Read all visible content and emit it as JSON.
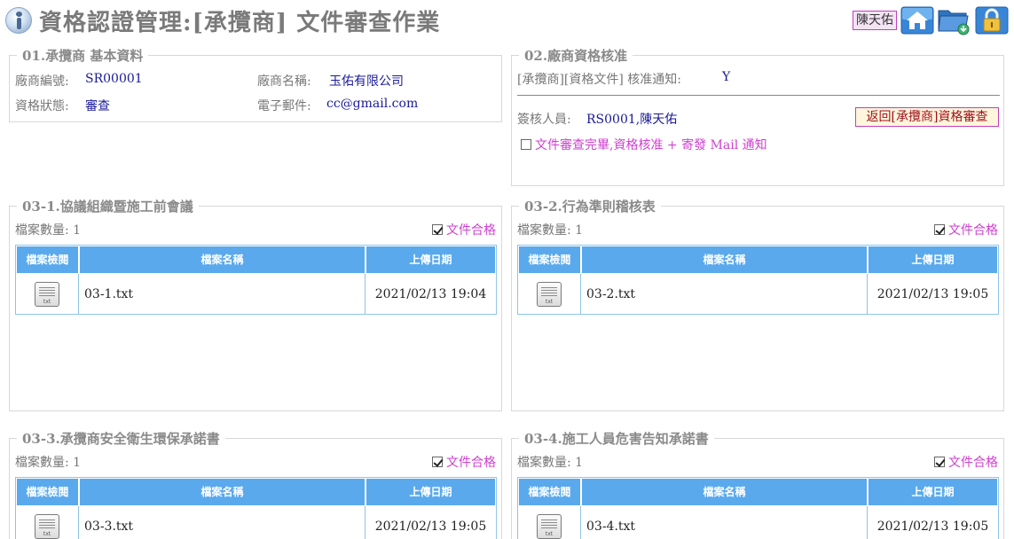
{
  "header": {
    "title": "資格認證管理:[承攬商] 文件審查作業",
    "user": "陳天佑",
    "icons": [
      "home-icon",
      "folder-icon",
      "lock-icon"
    ]
  },
  "section01": {
    "title": "01.承攬商 基本資料",
    "vendor_no_label": "廠商編號:",
    "vendor_no": "SR00001",
    "vendor_name_label": "廠商名稱:",
    "vendor_name": "玉佑有限公司",
    "status_label": "資格狀態:",
    "status": "審查",
    "email_label": "電子郵件:",
    "email": "cc@gmail.com"
  },
  "section02": {
    "title": "02.廠商資格核准",
    "notice_label": "[承攬商][資格文件] 核准通知:",
    "notice_value": "Y",
    "reviewer_label": "簽核人員:",
    "reviewer": "RS0001,陳天佑",
    "return_button": "返回[承攬商]資格審查",
    "approve_checkbox": "文件審查完畢,資格核准 + 寄發 Mail 通知",
    "approve_checked": false
  },
  "table_headers": {
    "view": "檔案檢閱",
    "filename": "檔案名稱",
    "upload_date": "上傳日期"
  },
  "common": {
    "count_label": "檔案數量:",
    "pass_label": "文件合格"
  },
  "doc_sections": [
    {
      "title": "03-1.協議組織暨施工前會議",
      "count": "1",
      "pass": true,
      "files": [
        {
          "icon": "txt-file-icon",
          "name": "03-1.txt",
          "date": "2021/02/13 19:04"
        }
      ]
    },
    {
      "title": "03-2.行為準則稽核表",
      "count": "1",
      "pass": true,
      "files": [
        {
          "icon": "txt-file-icon",
          "name": "03-2.txt",
          "date": "2021/02/13 19:05"
        }
      ]
    },
    {
      "title": "03-3.承攬商安全衛生環保承諾書",
      "count": "1",
      "pass": true,
      "files": [
        {
          "icon": "txt-file-icon",
          "name": "03-3.txt",
          "date": "2021/02/13 19:05"
        }
      ]
    },
    {
      "title": "03-4.施工人員危害告知承諾書",
      "count": "1",
      "pass": true,
      "files": [
        {
          "icon": "txt-file-icon",
          "name": "03-4.txt",
          "date": "2021/02/13 19:05"
        }
      ]
    }
  ]
}
